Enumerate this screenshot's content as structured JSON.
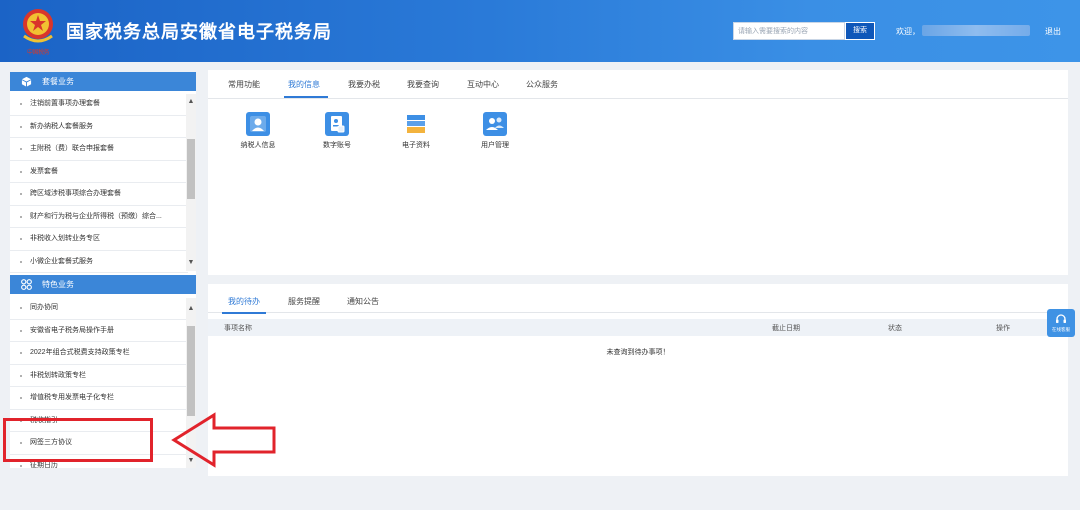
{
  "header": {
    "emblem_text": "中国税务",
    "title": "国家税务总局安徽省电子税务局",
    "search_placeholder": "请输入需要搜索的内容",
    "search_button": "搜索",
    "welcome": "欢迎，",
    "logout": "退出"
  },
  "sidebar": {
    "section1": {
      "title": "套餐业务",
      "items": [
        "注销前置事项办理套餐",
        "新办纳税人套餐服务",
        "主附税（费）联合申报套餐",
        "发票套餐",
        "跨区域涉税事项综合办理套餐",
        "财产和行为税与企业所得税（预缴）综合...",
        "非税收入划转业务专区",
        "小微企业套餐式服务"
      ]
    },
    "section2": {
      "title": "特色业务",
      "items": [
        "同办协同",
        "安徽省电子税务局操作手册",
        "2022年组合式税费支持政策专栏",
        "非税划转政策专栏",
        "增值税专用发票电子化专栏",
        "税收指引",
        "网签三方协议",
        "征期日历"
      ]
    }
  },
  "main": {
    "tabs": [
      "常用功能",
      "我的信息",
      "我要办税",
      "我要查询",
      "互动中心",
      "公众服务"
    ],
    "apps": [
      {
        "label": "纳税人信息",
        "icon": "taxpayer-info-icon"
      },
      {
        "label": "数字账号",
        "icon": "digital-account-icon"
      },
      {
        "label": "电子资料",
        "icon": "electronic-data-icon"
      },
      {
        "label": "用户管理",
        "icon": "user-management-icon"
      }
    ]
  },
  "todo": {
    "tabs": [
      "我的待办",
      "服务提醒",
      "通知公告"
    ],
    "columns": [
      "事项名称",
      "截止日期",
      "状态",
      "操作"
    ],
    "empty": "未查询到待办事项！"
  },
  "float": {
    "label": "在线客服"
  },
  "colors": {
    "header": "#2a7ad8",
    "accent": "#2f7ad6",
    "section": "#3b86d8",
    "annotation": "#e1232b"
  }
}
